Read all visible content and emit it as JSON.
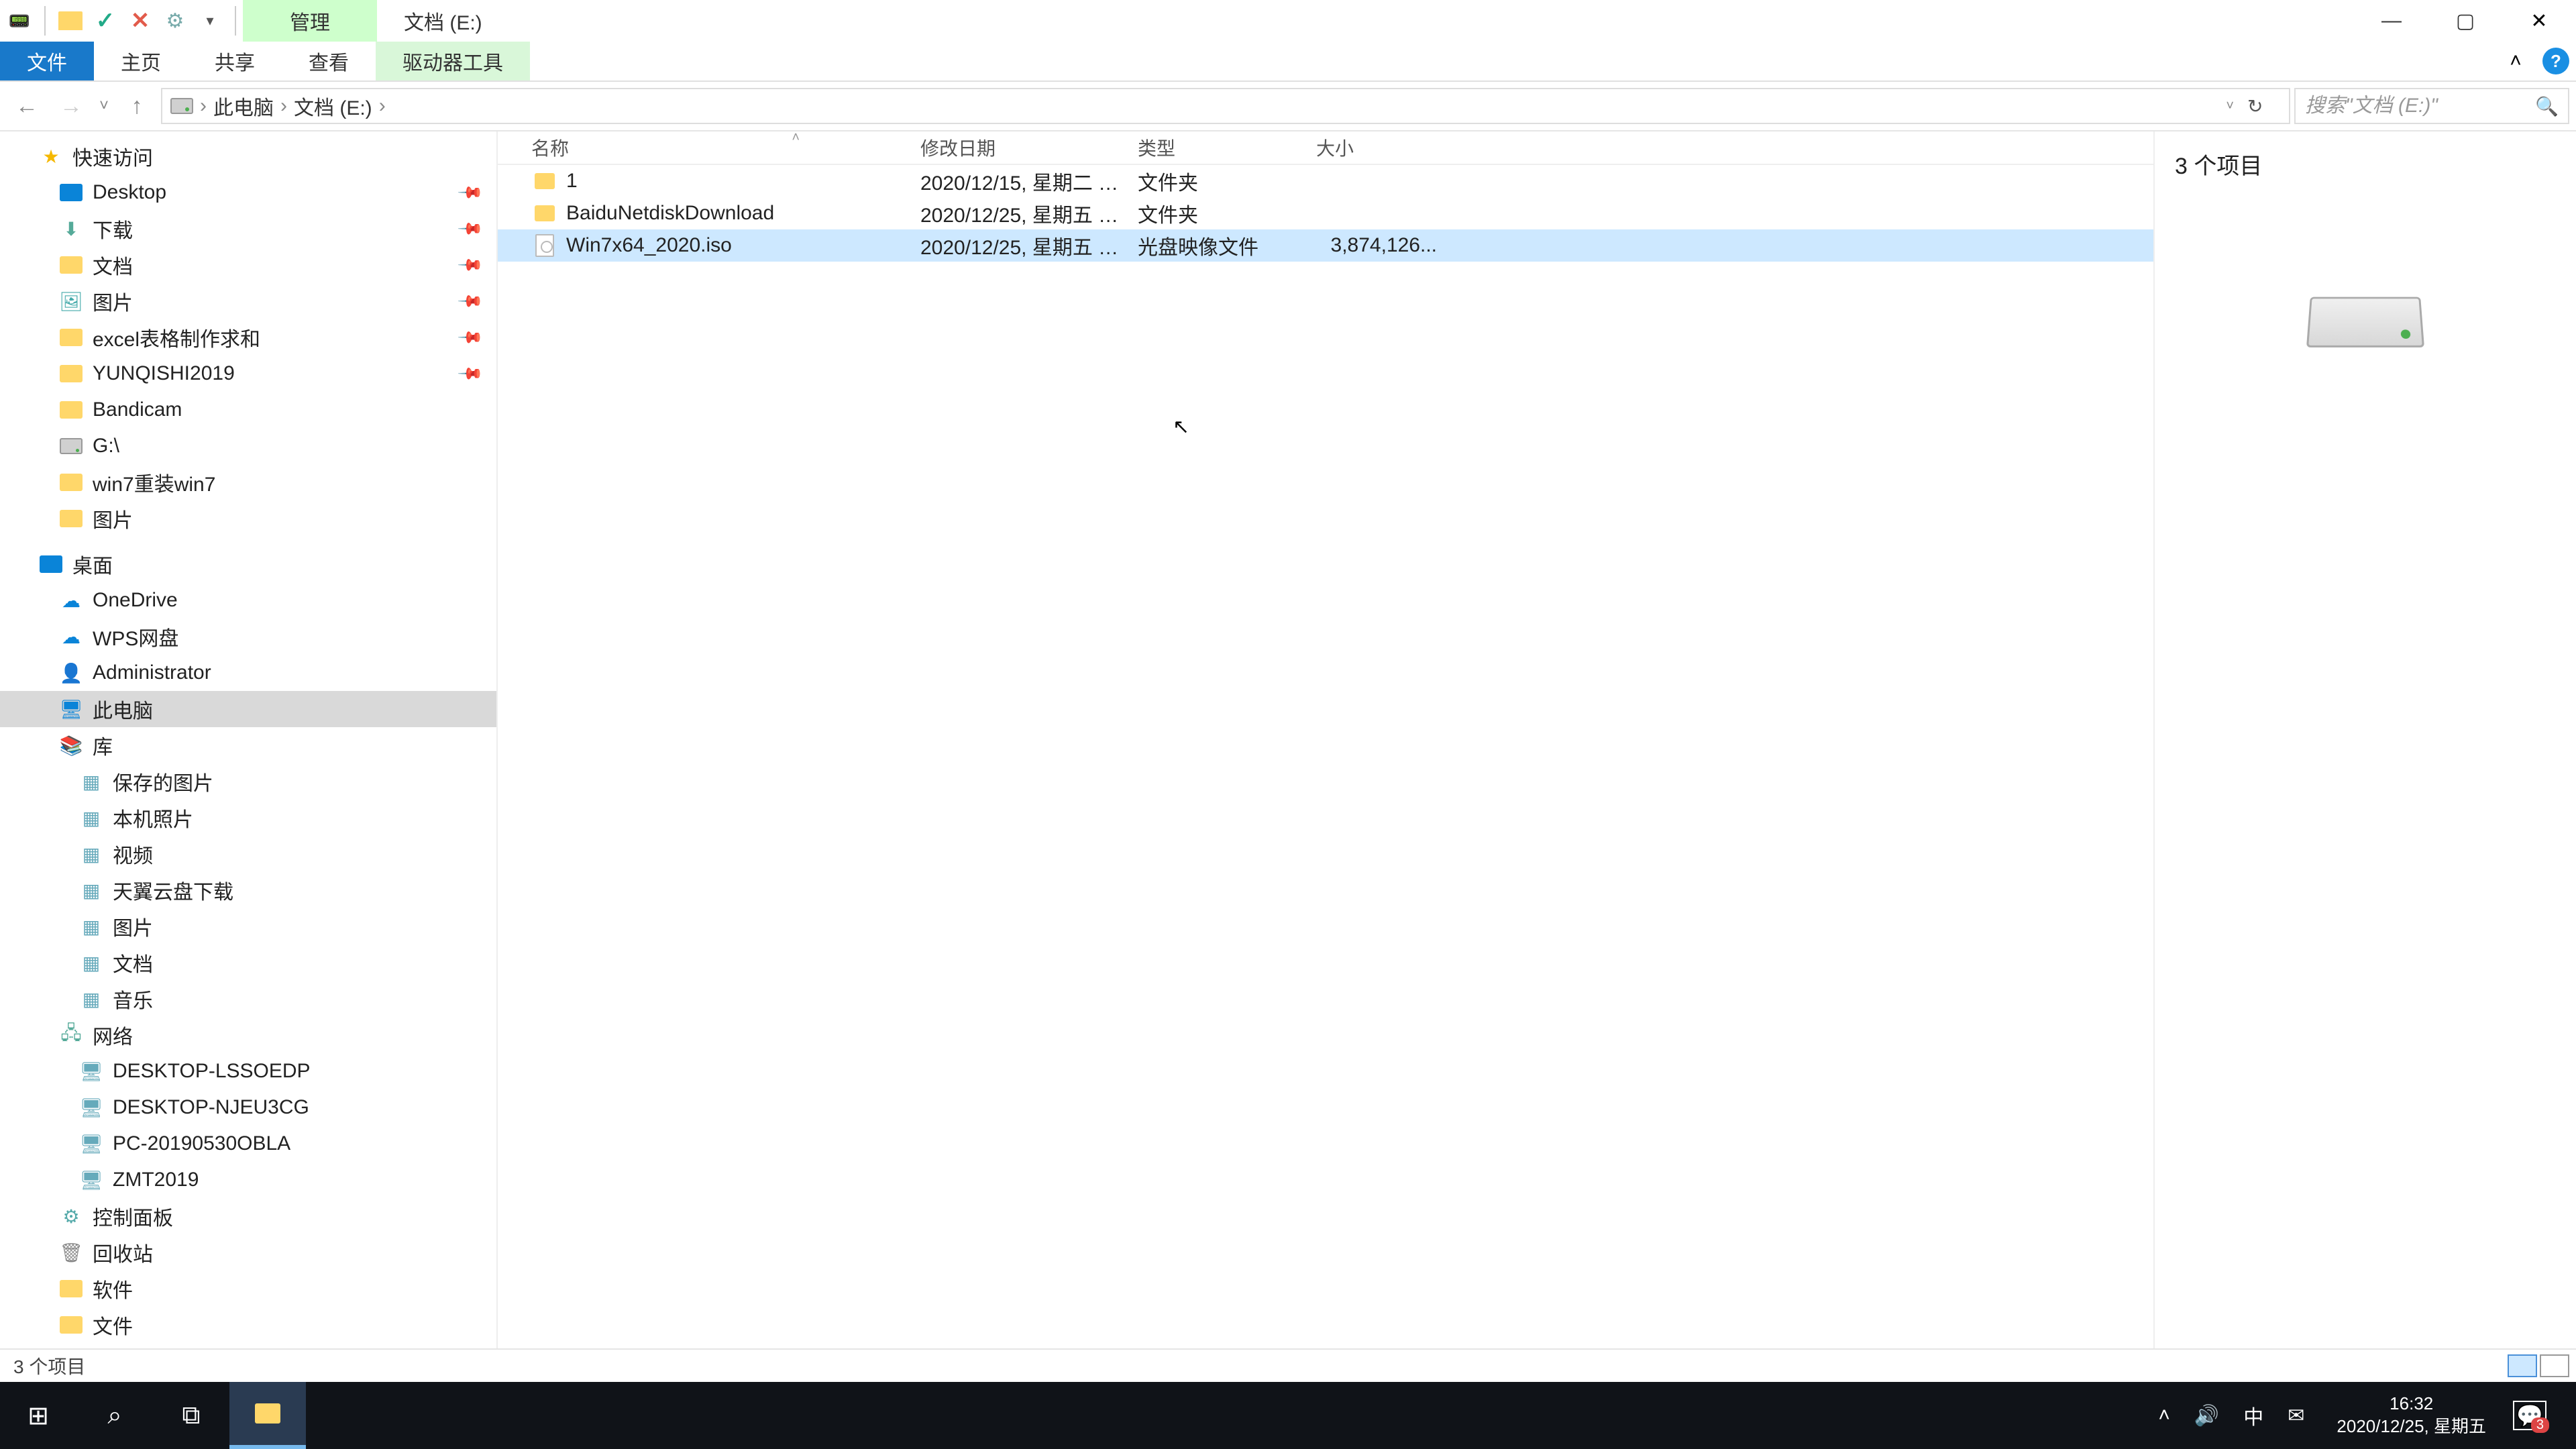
{
  "titlebar": {
    "context_tab": "管理",
    "title": "文档 (E:)"
  },
  "ribbon": {
    "file": "文件",
    "home": "主页",
    "share": "共享",
    "view": "查看",
    "drive_tools": "驱动器工具"
  },
  "addressbar": {
    "root": "此电脑",
    "current": "文档 (E:)"
  },
  "search": {
    "placeholder": "搜索\"文档 (E:)\""
  },
  "nav": {
    "quick_access": "快速访问",
    "qa_items": [
      {
        "label": "Desktop",
        "icon": "desktop",
        "pinned": true
      },
      {
        "label": "下载",
        "icon": "down",
        "pinned": true
      },
      {
        "label": "文档",
        "icon": "folder",
        "pinned": true
      },
      {
        "label": "图片",
        "icon": "pic",
        "pinned": true
      },
      {
        "label": "excel表格制作求和",
        "icon": "folder",
        "pinned": true
      },
      {
        "label": "YUNQISHI2019",
        "icon": "folder",
        "pinned": true
      },
      {
        "label": "Bandicam",
        "icon": "folder",
        "pinned": false
      },
      {
        "label": "G:\\",
        "icon": "drive",
        "pinned": false
      },
      {
        "label": "win7重装win7",
        "icon": "folder",
        "pinned": false
      },
      {
        "label": "图片",
        "icon": "folder",
        "pinned": false
      }
    ],
    "desktop": "桌面",
    "onedrive": "OneDrive",
    "wps": "WPS网盘",
    "admin": "Administrator",
    "thispc": "此电脑",
    "libraries": "库",
    "lib_items": [
      "保存的图片",
      "本机照片",
      "视频",
      "天翼云盘下载",
      "图片",
      "文档",
      "音乐"
    ],
    "network": "网络",
    "net_items": [
      "DESKTOP-LSSOEDP",
      "DESKTOP-NJEU3CG",
      "PC-20190530OBLA",
      "ZMT2019"
    ],
    "control_panel": "控制面板",
    "recycle": "回收站",
    "software": "软件",
    "files_folder": "文件"
  },
  "columns": {
    "name": "名称",
    "date": "修改日期",
    "type": "类型",
    "size": "大小"
  },
  "files": [
    {
      "name": "1",
      "date": "2020/12/15, 星期二 1...",
      "type": "文件夹",
      "size": "",
      "icon": "folder",
      "selected": false
    },
    {
      "name": "BaiduNetdiskDownload",
      "date": "2020/12/25, 星期五 1...",
      "type": "文件夹",
      "size": "",
      "icon": "folder",
      "selected": false
    },
    {
      "name": "Win7x64_2020.iso",
      "date": "2020/12/25, 星期五 1...",
      "type": "光盘映像文件",
      "size": "3,874,126...",
      "icon": "iso",
      "selected": true
    }
  ],
  "preview": {
    "count_label": "3 个项目"
  },
  "status": {
    "text": "3 个项目"
  },
  "taskbar": {
    "ime": "中",
    "time": "16:32",
    "date": "2020/12/25, 星期五",
    "notif_count": "3"
  }
}
